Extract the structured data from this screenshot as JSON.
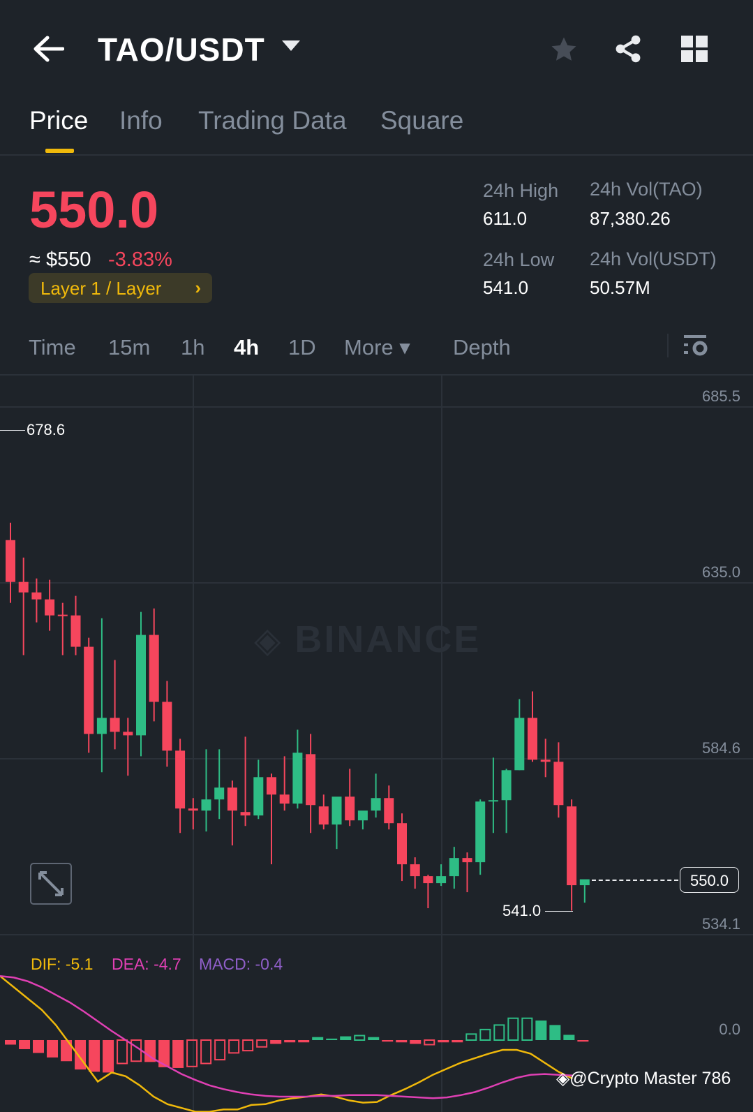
{
  "header": {
    "title": "TAO/USDT",
    "icons": [
      "back-arrow-icon",
      "caret-down-icon",
      "star-icon",
      "share-icon",
      "grid-icon"
    ]
  },
  "tabs": [
    {
      "label": "Price",
      "active": true
    },
    {
      "label": "Info"
    },
    {
      "label": "Trading Data"
    },
    {
      "label": "Square"
    }
  ],
  "ticker": {
    "last_price": "550.0",
    "approx_usd": "≈ $550",
    "change_pct": "-3.83%",
    "tag": "Layer 1 / Layer",
    "tag_chevron": "›",
    "stats": [
      {
        "label": "24h High",
        "value": "611.0"
      },
      {
        "label": "24h Vol(TAO)",
        "value": "87,380.26"
      },
      {
        "label": "24h Low",
        "value": "541.0"
      },
      {
        "label": "24h Vol(USDT)",
        "value": "50.57M"
      }
    ]
  },
  "intervals": [
    {
      "label": "Time"
    },
    {
      "label": "15m"
    },
    {
      "label": "1h"
    },
    {
      "label": "4h",
      "active": true
    },
    {
      "label": "1D"
    },
    {
      "label": "More ▾"
    },
    {
      "label": "Depth"
    }
  ],
  "colors": {
    "up": "#2ebd85",
    "down": "#f6465d",
    "accent": "#f0b90b",
    "dif": "#f0b90b",
    "dea": "#e040b4",
    "macd": "#8f5fc8"
  },
  "chart_data": {
    "type": "candlestick",
    "y_axis_labels": [
      "685.5",
      "635.0",
      "584.6",
      "534.1"
    ],
    "ylim": [
      534.1,
      685.5
    ],
    "watermark": "BINANCE",
    "high_marker": "678.6",
    "low_marker": "541.0",
    "current_price_label": "550.0",
    "candles": [
      [
        647.3,
        652.3,
        629.3,
        635.3
      ],
      [
        635.3,
        642.3,
        614.3,
        632.3
      ],
      [
        632.3,
        636.3,
        623.7,
        630.3
      ],
      [
        630.3,
        635.9,
        621.3,
        625.7
      ],
      [
        625.9,
        629.3,
        614.3,
        625.7
      ],
      [
        625.7,
        631.3,
        614.3,
        616.7
      ],
      [
        616.7,
        619.3,
        586.3,
        591.7
      ],
      [
        591.7,
        624.9,
        580.7,
        596.3
      ],
      [
        596.3,
        612.9,
        587.3,
        592.3
      ],
      [
        592.3,
        596.3,
        579.7,
        591.3
      ],
      [
        591.3,
        626.7,
        585.3,
        620.1
      ],
      [
        620.1,
        627.7,
        595.3,
        600.9
      ],
      [
        600.9,
        606.9,
        582.3,
        586.9
      ],
      [
        586.9,
        590.3,
        563.3,
        570.3
      ],
      [
        570.3,
        573.3,
        564.3,
        569.7
      ],
      [
        569.7,
        587.3,
        563.7,
        572.9
      ],
      [
        572.9,
        587.3,
        567.3,
        576.3
      ],
      [
        576.3,
        578.3,
        559.7,
        569.7
      ],
      [
        569.3,
        590.9,
        565.3,
        568.3
      ],
      [
        568.3,
        584.3,
        567.3,
        579.3
      ],
      [
        579.3,
        580.3,
        554.3,
        574.3
      ],
      [
        574.3,
        585.3,
        569.7,
        571.7
      ],
      [
        571.7,
        592.9,
        570.3,
        586.3
      ],
      [
        585.9,
        591.7,
        563.3,
        571.3
      ],
      [
        570.9,
        574.3,
        564.3,
        565.7
      ],
      [
        565.7,
        573.3,
        558.7,
        573.7
      ],
      [
        573.7,
        581.7,
        565.3,
        566.9
      ],
      [
        566.9,
        568.9,
        564.3,
        569.7
      ],
      [
        569.7,
        580.3,
        567.7,
        573.3
      ],
      [
        573.3,
        576.9,
        564.3,
        566.1
      ],
      [
        566.1,
        568.9,
        549.5,
        554.3
      ],
      [
        554.3,
        556.3,
        547.3,
        550.9
      ],
      [
        550.9,
        551.3,
        541.7,
        548.9
      ],
      [
        548.9,
        554.3,
        548.1,
        550.9
      ],
      [
        550.9,
        559.3,
        547.3,
        556.1
      ],
      [
        556.1,
        557.7,
        546.3,
        554.9
      ],
      [
        554.9,
        572.9,
        551.3,
        572.3
      ],
      [
        572.3,
        584.9,
        563.3,
        572.7
      ],
      [
        572.7,
        581.7,
        563.3,
        581.3
      ],
      [
        581.3,
        601.7,
        581.3,
        596.3
      ],
      [
        596.3,
        603.9,
        583.7,
        584.3
      ],
      [
        584.3,
        590.3,
        579.3,
        583.7
      ],
      [
        583.7,
        589.3,
        567.7,
        571.3
      ],
      [
        570.9,
        572.9,
        541.0,
        548.3
      ],
      [
        548.3,
        548.3,
        543.3,
        550.0
      ]
    ],
    "macd": {
      "labels": {
        "dif": "DIF: -5.1",
        "dea": "DEA: -4.7",
        "macd": "MACD: -0.4"
      },
      "zero_label": "0.0",
      "histogram": [
        -0.6,
        -1.2,
        -1.7,
        -2.3,
        -2.8,
        -3.9,
        -4.2,
        -4.3,
        -3.1,
        -2.8,
        -2.9,
        -3.6,
        -3.7,
        -3.5,
        -3.1,
        -2.6,
        -1.7,
        -1.4,
        -0.9,
        -0.5,
        -0.3,
        -0.3,
        0.4,
        0.2,
        0.5,
        0.6,
        0.4,
        -0.2,
        -0.3,
        -0.5,
        -0.6,
        -0.3,
        -0.3,
        0.8,
        1.4,
        2.0,
        2.9,
        2.9,
        2.6,
        2.0,
        0.7,
        -0.2
      ],
      "hollow": [
        0,
        0,
        0,
        0,
        0,
        0,
        0,
        0,
        1,
        1,
        0,
        0,
        0,
        1,
        1,
        1,
        1,
        1,
        1,
        0,
        0,
        0,
        0,
        0,
        0,
        1,
        0,
        0,
        0,
        0,
        1,
        0,
        0,
        1,
        1,
        1,
        1,
        1,
        0,
        0,
        0,
        0
      ],
      "dif": [
        8.5,
        7.0,
        5.5,
        4.0,
        2.0,
        -0.5,
        -3.0,
        -5.5,
        -4.3,
        -4.8,
        -6.0,
        -7.5,
        -8.5,
        -9.0,
        -9.5,
        -9.5,
        -9.2,
        -9.2,
        -8.6,
        -8.5,
        -8.0,
        -7.7,
        -7.5,
        -7.2,
        -7.5,
        -8.0,
        -8.3,
        -8.2,
        -7.3,
        -6.5,
        -5.6,
        -4.6,
        -3.8,
        -3.0,
        -2.4,
        -1.8,
        -1.3,
        -1.3,
        -1.8,
        -3.0,
        -4.2,
        -5.1
      ],
      "dea": [
        8.5,
        8.3,
        7.8,
        7.0,
        6.0,
        5.0,
        3.8,
        2.5,
        1.2,
        0,
        -1.2,
        -2.5,
        -3.5,
        -4.5,
        -5.3,
        -6.0,
        -6.5,
        -6.9,
        -7.2,
        -7.4,
        -7.5,
        -7.5,
        -7.5,
        -7.4,
        -7.4,
        -7.3,
        -7.3,
        -7.3,
        -7.4,
        -7.5,
        -7.6,
        -7.7,
        -7.6,
        -7.3,
        -6.9,
        -6.3,
        -5.6,
        -5.0,
        -4.6,
        -4.5,
        -4.6,
        -4.7
      ]
    }
  },
  "watermark_credit": "@Crypto Master 786"
}
